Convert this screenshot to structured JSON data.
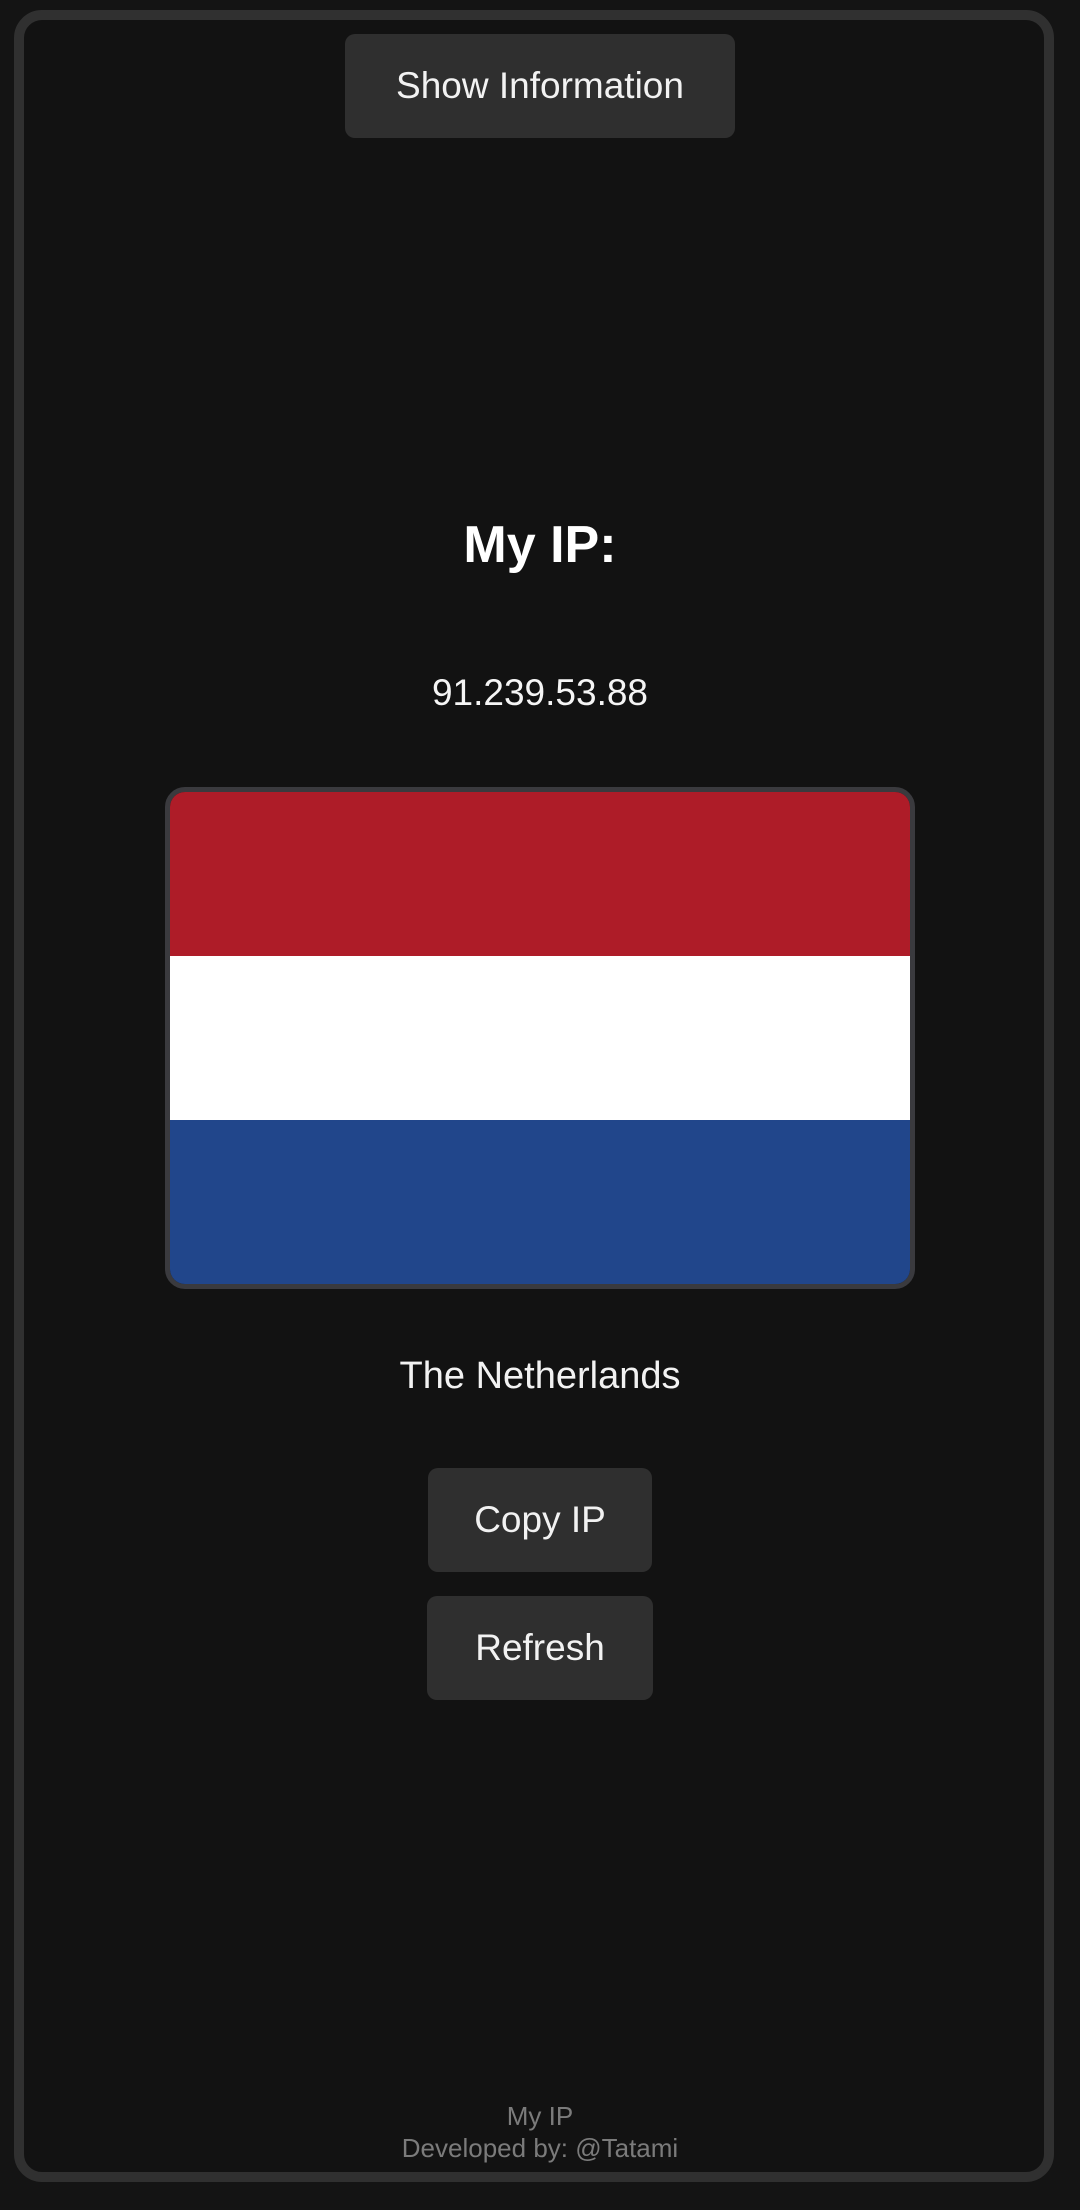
{
  "header": {
    "show_info_label": "Show Information"
  },
  "main": {
    "title": "My IP:",
    "ip": "91.239.53.88",
    "country": "The Netherlands",
    "flag": {
      "colors": [
        "#AE1C28",
        "#FFFFFF",
        "#21468B"
      ]
    }
  },
  "actions": {
    "copy_label": "Copy IP",
    "refresh_label": "Refresh"
  },
  "footer": {
    "app_name": "My IP",
    "developer": "Developed by: @Tatami"
  }
}
